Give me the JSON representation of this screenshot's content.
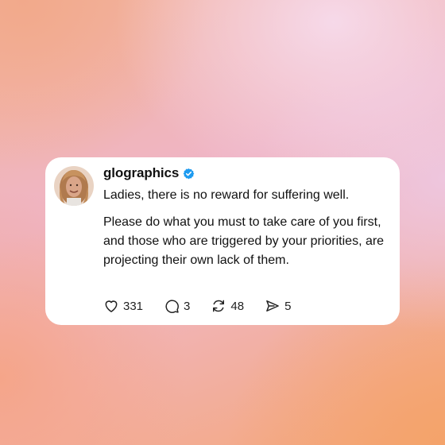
{
  "post": {
    "username": "glographics",
    "verified_icon": "verified-badge-icon",
    "paragraphs": [
      "Ladies, there is no reward for suffering well.",
      "Please do what you must to take care of you first, and those who are triggered by your priorities, are projecting their own lack of them."
    ]
  },
  "actions": {
    "like": {
      "icon": "heart-icon",
      "count": "331"
    },
    "reply": {
      "icon": "comment-icon",
      "count": "3"
    },
    "repost": {
      "icon": "repost-icon",
      "count": "48"
    },
    "share": {
      "icon": "send-icon",
      "count": "5"
    }
  },
  "colors": {
    "verified": "#1d9bf0",
    "card": "#ffffff",
    "text": "#111111"
  }
}
